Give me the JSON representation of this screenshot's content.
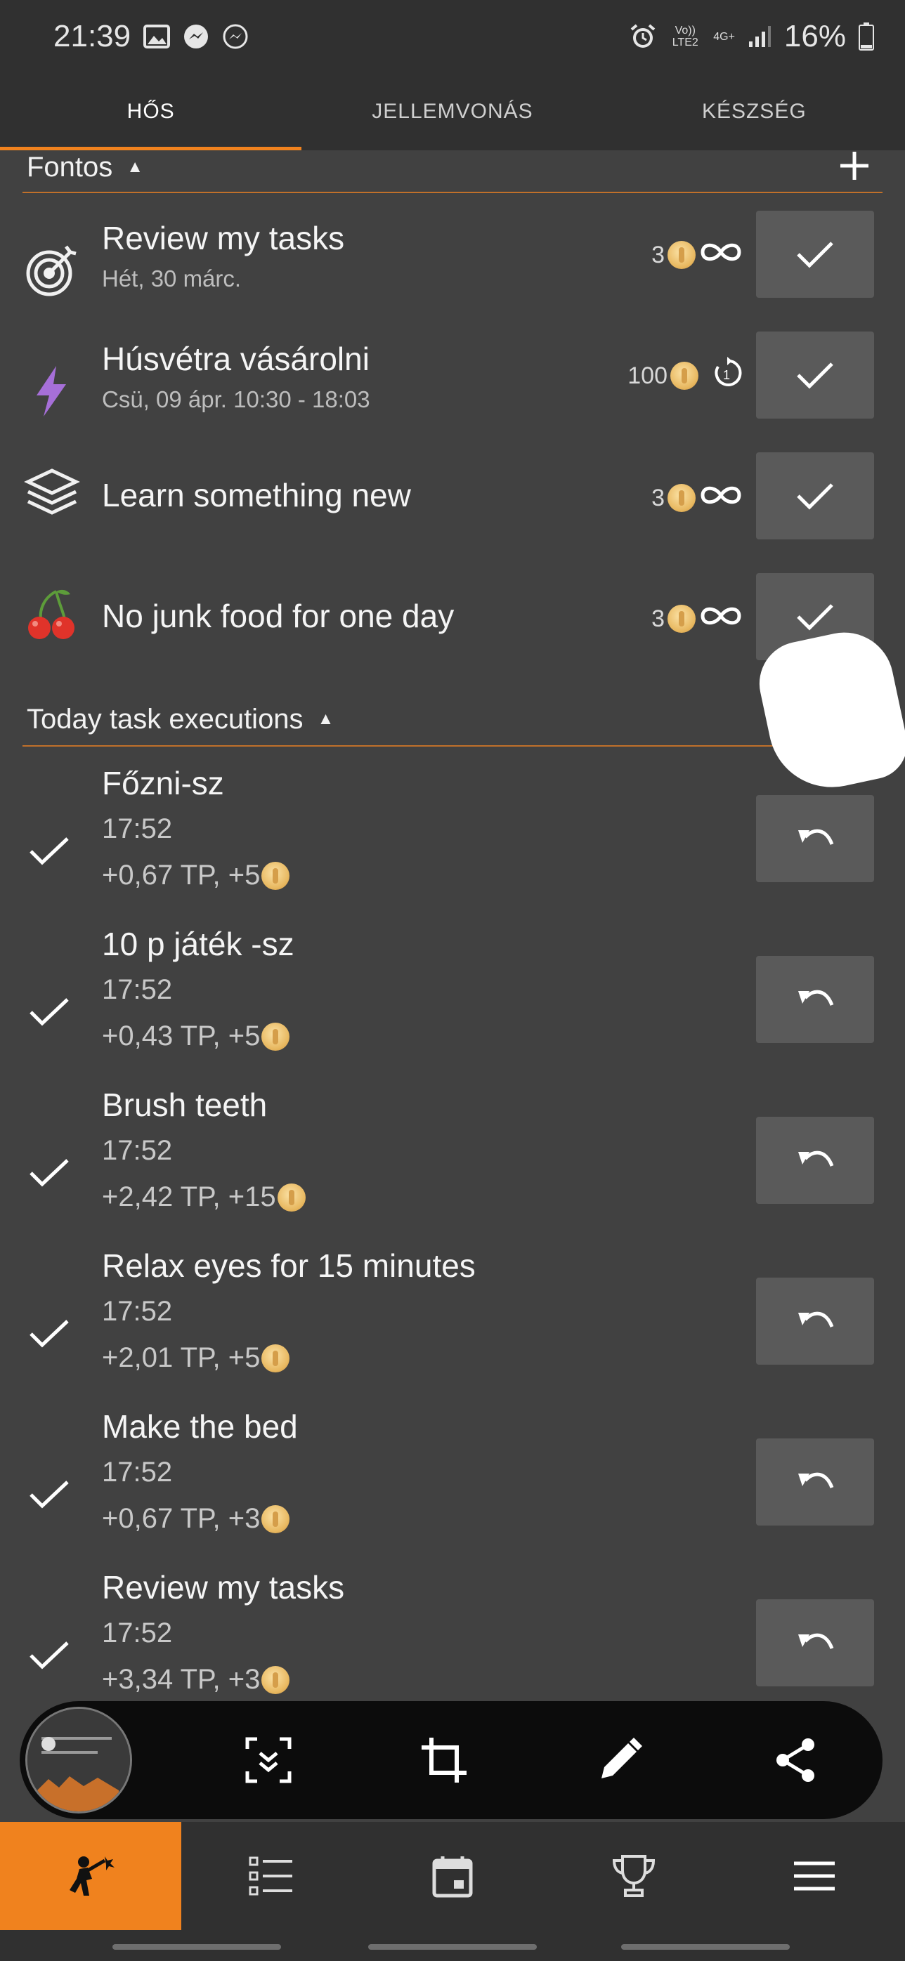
{
  "status_bar": {
    "time": "21:39",
    "volte": "Vo)) LTE2",
    "network": "4G+",
    "battery": "16%"
  },
  "tabs": [
    {
      "label": "HŐS",
      "active": true
    },
    {
      "label": "JELLEMVONÁS",
      "active": false
    },
    {
      "label": "KÉSZSÉG",
      "active": false
    }
  ],
  "important_section": {
    "title": "Fontos"
  },
  "tasks": [
    {
      "icon": "target-icon",
      "title": "Review my tasks",
      "subtitle": "Hét, 30 márc.",
      "reward": "3",
      "repeat": "infinity-icon"
    },
    {
      "icon": "lightning-icon",
      "title": "Húsvétra vásárolni",
      "subtitle": "Csü, 09 ápr. 10:30 - 18:03",
      "reward": "100",
      "repeat": "repeat-once-icon"
    },
    {
      "icon": "layers-icon",
      "title": "Learn something new",
      "subtitle": "",
      "reward": "3",
      "repeat": "infinity-icon"
    },
    {
      "icon": "cherry-icon",
      "title": "No junk food for one day",
      "subtitle": "",
      "reward": "3",
      "repeat": "infinity-icon"
    }
  ],
  "executions_section": {
    "title": "Today task executions"
  },
  "executions": [
    {
      "title": "Főzni-sz",
      "time": "17:52",
      "reward": "+0,67 TP, +5"
    },
    {
      "title": "10 p játék -sz",
      "time": "17:52",
      "reward": "+0,43 TP, +5"
    },
    {
      "title": "Brush teeth",
      "time": "17:52",
      "reward": "+2,42 TP, +15"
    },
    {
      "title": "Relax eyes for 15 minutes",
      "time": "17:52",
      "reward": "+2,01 TP, +5"
    },
    {
      "title": "Make the bed",
      "time": "17:52",
      "reward": "+0,67 TP, +3"
    },
    {
      "title": "Review my tasks",
      "time": "17:52",
      "reward": "+3,34 TP, +3"
    }
  ],
  "colors": {
    "accent": "#f0821e",
    "background": "#414141",
    "bar": "#303030",
    "button": "#5a5a5a"
  }
}
